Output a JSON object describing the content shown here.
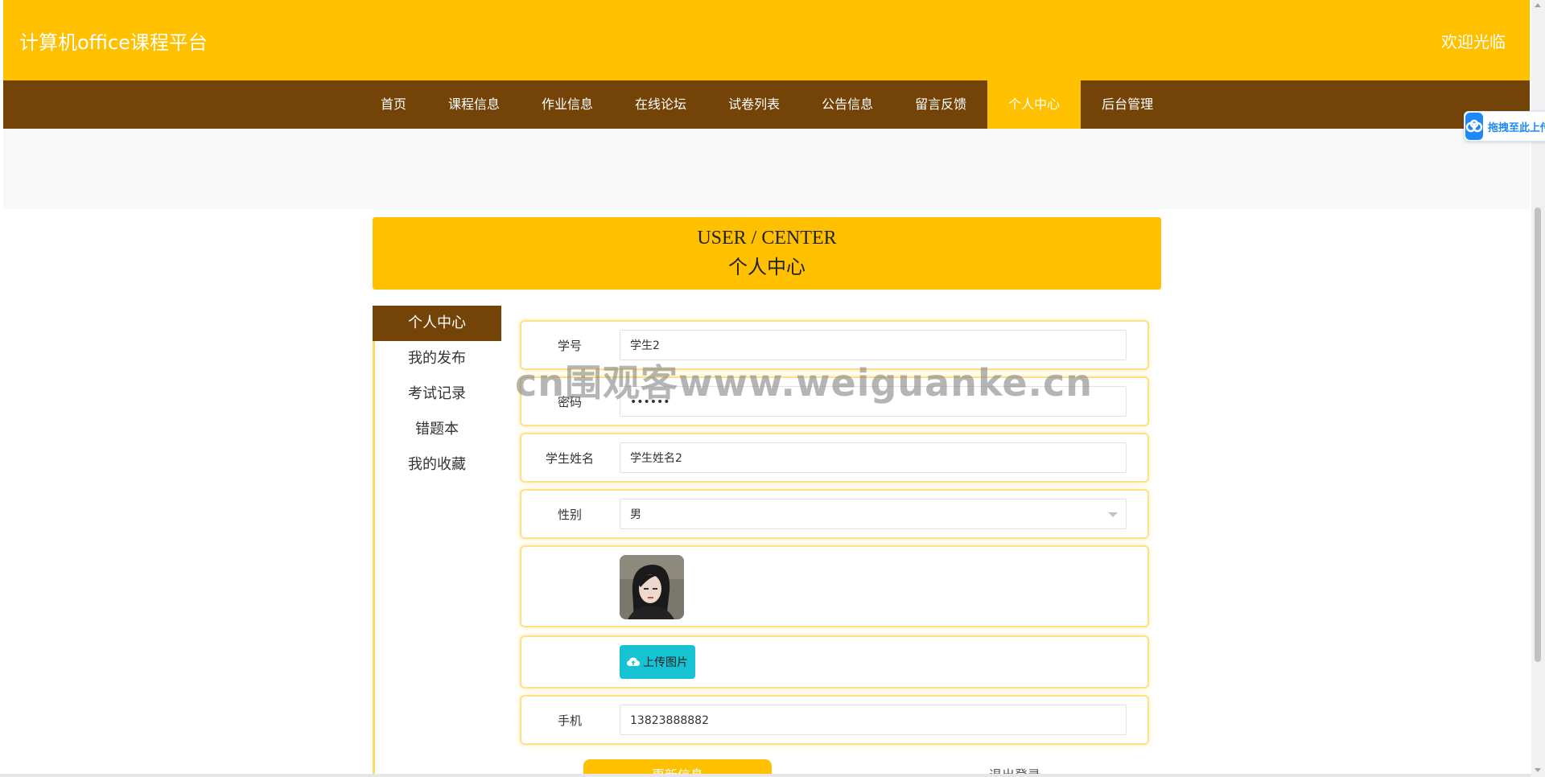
{
  "header": {
    "site_title": "计算机office课程平台",
    "welcome": "欢迎光临",
    "brand_color": "#FFC000",
    "nav_color": "#744308"
  },
  "nav": {
    "items": [
      {
        "label": "首页"
      },
      {
        "label": "课程信息"
      },
      {
        "label": "作业信息"
      },
      {
        "label": "在线论坛"
      },
      {
        "label": "试卷列表"
      },
      {
        "label": "公告信息"
      },
      {
        "label": "留言反馈"
      },
      {
        "label": "个人中心",
        "active": true
      },
      {
        "label": "后台管理"
      }
    ]
  },
  "banner": {
    "en": "USER / CENTER",
    "cn": "个人中心"
  },
  "sidebar": {
    "items": [
      {
        "label": "个人中心",
        "active": true
      },
      {
        "label": "我的发布"
      },
      {
        "label": "考试记录"
      },
      {
        "label": "错题本"
      },
      {
        "label": "我的收藏"
      }
    ]
  },
  "form": {
    "student_no": {
      "label": "学号",
      "value": "学生2"
    },
    "password": {
      "label": "密码",
      "value": "••••••"
    },
    "student_name": {
      "label": "学生姓名",
      "value": "学生姓名2"
    },
    "gender": {
      "label": "性别",
      "value": "男"
    },
    "upload": {
      "label": "上传图片",
      "icon": "cloud-upload-icon"
    },
    "phone": {
      "label": "手机",
      "value": "13823888882"
    },
    "update_button": "更新信息",
    "logout_button": "退出登录"
  },
  "watermark": "cn围观客www.weiguanke.cn",
  "drag_widget": {
    "label": "拖拽至此上传"
  }
}
